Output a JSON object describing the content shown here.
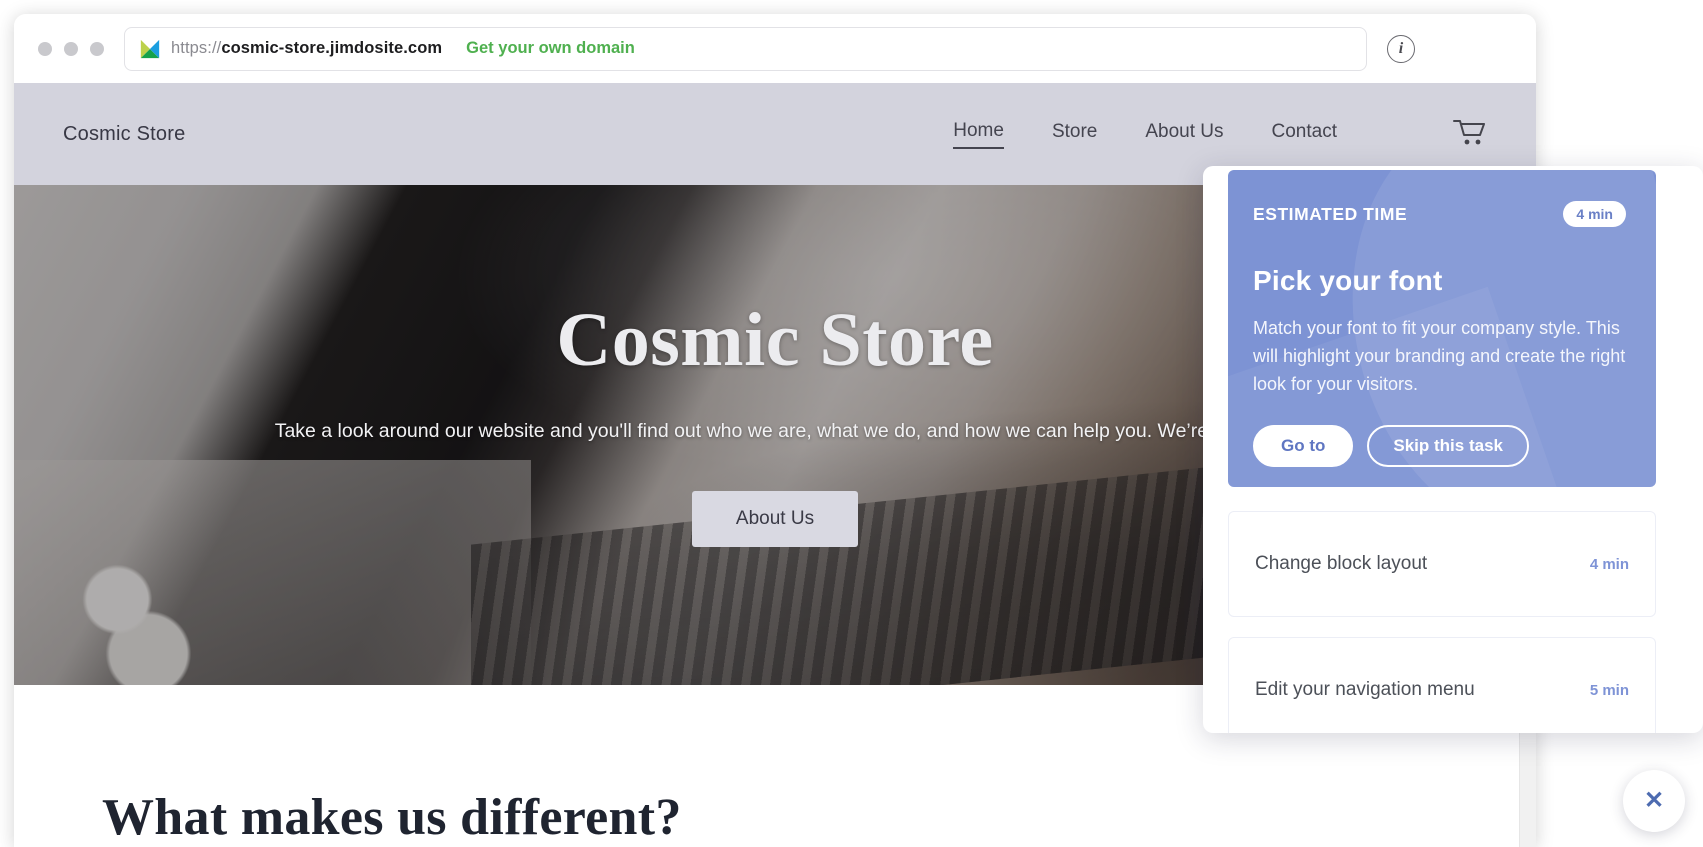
{
  "browser": {
    "url_scheme": "https://",
    "url_domain": "cosmic-store.jimdosite.com",
    "get_domain_link": "Get your own domain",
    "info_glyph": "i",
    "logo_icon": "jimdo-logo-icon"
  },
  "site": {
    "logo_text": "Cosmic Store",
    "nav": [
      {
        "label": "Home",
        "active": true
      },
      {
        "label": "Store",
        "active": false
      },
      {
        "label": "About Us",
        "active": false
      },
      {
        "label": "Contact",
        "active": false
      }
    ],
    "cart_icon": "shopping-cart-icon",
    "hero": {
      "title": "Cosmic Store",
      "subtitle": "Take a look around our website and you'll find out who we are, what we do, and how we can help you. We’re excited",
      "cta_label": "About Us"
    },
    "section_heading": "What makes us different?"
  },
  "task_panel": {
    "active_task": {
      "eyebrow": "ESTIMATED TIME",
      "time_badge": "4 min",
      "title": "Pick your font",
      "description": "Match your font to fit your company style. This will highlight your branding and create the right look for your visitors.",
      "primary_button": "Go to",
      "secondary_button": "Skip this task"
    },
    "tasks": [
      {
        "label": "Change block layout",
        "time": "4 min"
      },
      {
        "label": "Edit your navigation menu",
        "time": "5 min"
      }
    ],
    "close_icon": "close-icon",
    "close_glyph": "✕"
  },
  "scrollbar": {
    "up_icon": "scroll-up-arrow-icon",
    "down_icon": "scroll-down-arrow-icon"
  },
  "colors": {
    "accent_blue": "#7d93d4",
    "link_green": "#4fb04f",
    "header_bg": "#d3d3dd",
    "task_time": "#7e93d6"
  }
}
